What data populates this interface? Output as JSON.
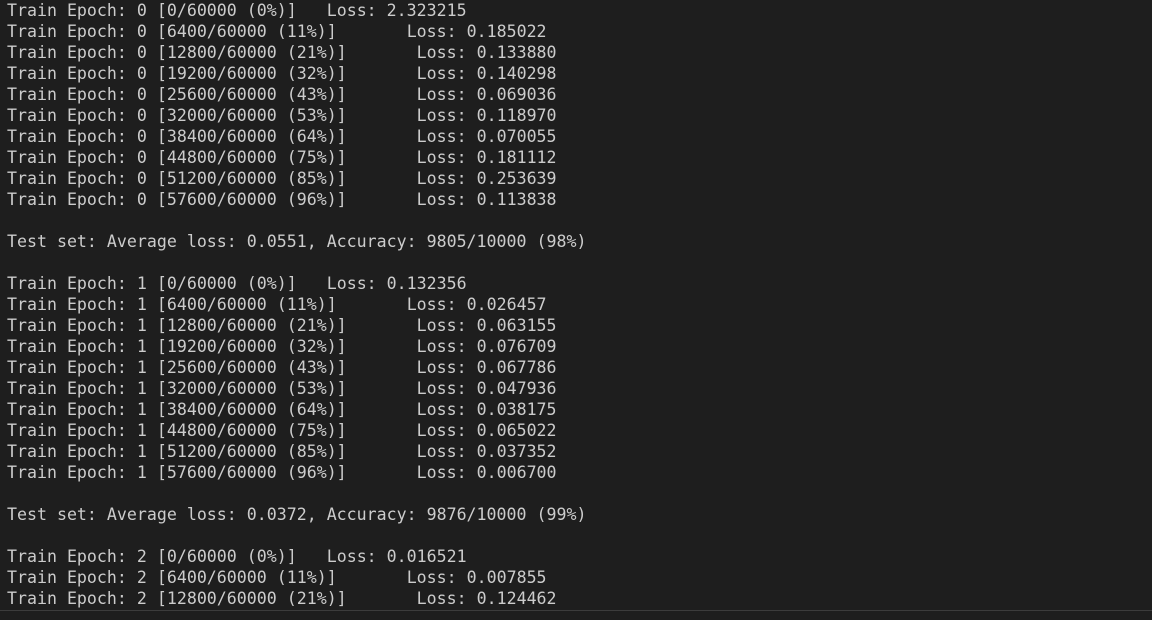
{
  "terminal": {
    "lines": [
      {
        "kind": "train",
        "prefix": "Train Epoch: 0 [0/60000 (0%)]",
        "loss": "Loss: 2.323215",
        "tab": "narrow"
      },
      {
        "kind": "train",
        "prefix": "Train Epoch: 0 [6400/60000 (11%)]",
        "loss": "Loss: 0.185022",
        "tab": "wide"
      },
      {
        "kind": "train",
        "prefix": "Train Epoch: 0 [12800/60000 (21%)]",
        "loss": "Loss: 0.133880",
        "tab": "wide"
      },
      {
        "kind": "train",
        "prefix": "Train Epoch: 0 [19200/60000 (32%)]",
        "loss": "Loss: 0.140298",
        "tab": "wide"
      },
      {
        "kind": "train",
        "prefix": "Train Epoch: 0 [25600/60000 (43%)]",
        "loss": "Loss: 0.069036",
        "tab": "wide"
      },
      {
        "kind": "train",
        "prefix": "Train Epoch: 0 [32000/60000 (53%)]",
        "loss": "Loss: 0.118970",
        "tab": "wide"
      },
      {
        "kind": "train",
        "prefix": "Train Epoch: 0 [38400/60000 (64%)]",
        "loss": "Loss: 0.070055",
        "tab": "wide"
      },
      {
        "kind": "train",
        "prefix": "Train Epoch: 0 [44800/60000 (75%)]",
        "loss": "Loss: 0.181112",
        "tab": "wide"
      },
      {
        "kind": "train",
        "prefix": "Train Epoch: 0 [51200/60000 (85%)]",
        "loss": "Loss: 0.253639",
        "tab": "wide"
      },
      {
        "kind": "train",
        "prefix": "Train Epoch: 0 [57600/60000 (96%)]",
        "loss": "Loss: 0.113838",
        "tab": "wide"
      },
      {
        "kind": "blank"
      },
      {
        "kind": "test",
        "text": "Test set: Average loss: 0.0551, Accuracy: 9805/10000 (98%)"
      },
      {
        "kind": "blank"
      },
      {
        "kind": "train",
        "prefix": "Train Epoch: 1 [0/60000 (0%)]",
        "loss": "Loss: 0.132356",
        "tab": "narrow"
      },
      {
        "kind": "train",
        "prefix": "Train Epoch: 1 [6400/60000 (11%)]",
        "loss": "Loss: 0.026457",
        "tab": "wide"
      },
      {
        "kind": "train",
        "prefix": "Train Epoch: 1 [12800/60000 (21%)]",
        "loss": "Loss: 0.063155",
        "tab": "wide"
      },
      {
        "kind": "train",
        "prefix": "Train Epoch: 1 [19200/60000 (32%)]",
        "loss": "Loss: 0.076709",
        "tab": "wide"
      },
      {
        "kind": "train",
        "prefix": "Train Epoch: 1 [25600/60000 (43%)]",
        "loss": "Loss: 0.067786",
        "tab": "wide"
      },
      {
        "kind": "train",
        "prefix": "Train Epoch: 1 [32000/60000 (53%)]",
        "loss": "Loss: 0.047936",
        "tab": "wide"
      },
      {
        "kind": "train",
        "prefix": "Train Epoch: 1 [38400/60000 (64%)]",
        "loss": "Loss: 0.038175",
        "tab": "wide"
      },
      {
        "kind": "train",
        "prefix": "Train Epoch: 1 [44800/60000 (75%)]",
        "loss": "Loss: 0.065022",
        "tab": "wide"
      },
      {
        "kind": "train",
        "prefix": "Train Epoch: 1 [51200/60000 (85%)]",
        "loss": "Loss: 0.037352",
        "tab": "wide"
      },
      {
        "kind": "train",
        "prefix": "Train Epoch: 1 [57600/60000 (96%)]",
        "loss": "Loss: 0.006700",
        "tab": "wide"
      },
      {
        "kind": "blank"
      },
      {
        "kind": "test",
        "text": "Test set: Average loss: 0.0372, Accuracy: 9876/10000 (99%)"
      },
      {
        "kind": "blank"
      },
      {
        "kind": "train",
        "prefix": "Train Epoch: 2 [0/60000 (0%)]",
        "loss": "Loss: 0.016521",
        "tab": "narrow"
      },
      {
        "kind": "train",
        "prefix": "Train Epoch: 2 [6400/60000 (11%)]",
        "loss": "Loss: 0.007855",
        "tab": "wide"
      },
      {
        "kind": "train",
        "prefix": "Train Epoch: 2 [12800/60000 (21%)]",
        "loss": "Loss: 0.124462",
        "tab": "wide"
      }
    ]
  }
}
